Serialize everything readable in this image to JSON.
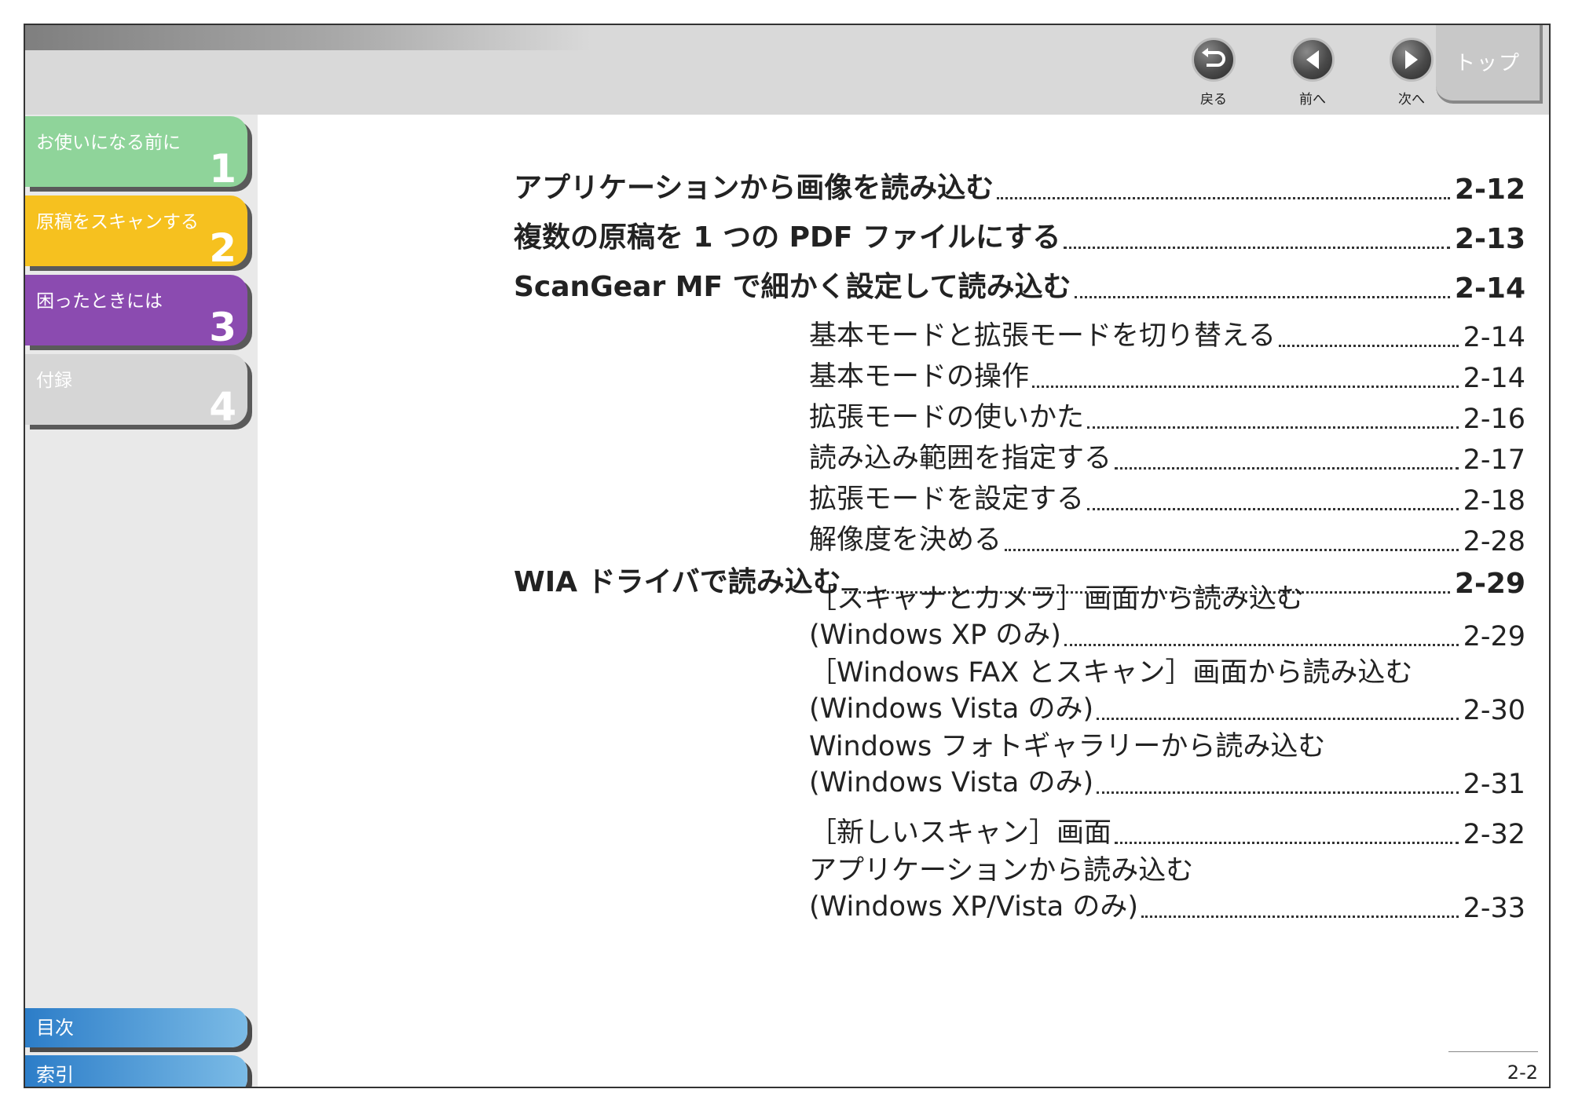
{
  "topbar": {
    "back_label": "戻る",
    "prev_label": "前へ",
    "next_label": "次へ",
    "top_label": "トップ"
  },
  "sidebar": {
    "chapters": [
      {
        "title": "お使いになる前に",
        "number": "1",
        "color": "#8fd49a"
      },
      {
        "title": "原稿をスキャンする",
        "number": "2",
        "color": "#f6c11f"
      },
      {
        "title": "困ったときには",
        "number": "3",
        "color": "#8b4bb0"
      },
      {
        "title": "付録",
        "number": "4",
        "color": "#d6d6d6"
      }
    ],
    "contents_label": "目次",
    "index_label": "索引"
  },
  "toc": [
    {
      "level": "main",
      "text": "アプリケーションから画像を読み込む",
      "page": "2-12"
    },
    {
      "level": "main",
      "text": "複数の原稿を 1 つの PDF ファイルにする",
      "page": "2-13"
    },
    {
      "level": "main",
      "text": "ScanGear MF で細かく設定して読み込む",
      "page": "2-14"
    },
    {
      "level": "sub",
      "text": "基本モードと拡張モードを切り替える",
      "page": "2-14"
    },
    {
      "level": "sub",
      "text": "基本モードの操作",
      "page": "2-14"
    },
    {
      "level": "sub",
      "text": "拡張モードの使いかた",
      "page": "2-16"
    },
    {
      "level": "sub",
      "text": "読み込み範囲を指定する",
      "page": "2-17"
    },
    {
      "level": "sub",
      "text": "拡張モードを設定する",
      "page": "2-18"
    },
    {
      "level": "sub",
      "text": "解像度を決める",
      "page": "2-28"
    },
    {
      "level": "main",
      "text": "WIA ドライバで読み込む",
      "page": "2-29"
    },
    {
      "level": "sub2",
      "line1": "［スキャナとカメラ］画面から読み込む",
      "text": "(Windows XP のみ)",
      "page": "2-29"
    },
    {
      "level": "sub2",
      "line1": "［Windows FAX とスキャン］画面から読み込む",
      "text": "(Windows Vista のみ)",
      "page": "2-30"
    },
    {
      "level": "sub2",
      "line1": "Windows フォトギャラリーから読み込む",
      "text": "(Windows Vista のみ)",
      "page": "2-31"
    },
    {
      "level": "sub",
      "text": "［新しいスキャン］画面",
      "page": "2-32"
    },
    {
      "level": "sub2",
      "line1": "アプリケーションから読み込む",
      "text": "(Windows XP/Vista のみ)",
      "page": "2-33"
    }
  ],
  "page_number": "2-2"
}
